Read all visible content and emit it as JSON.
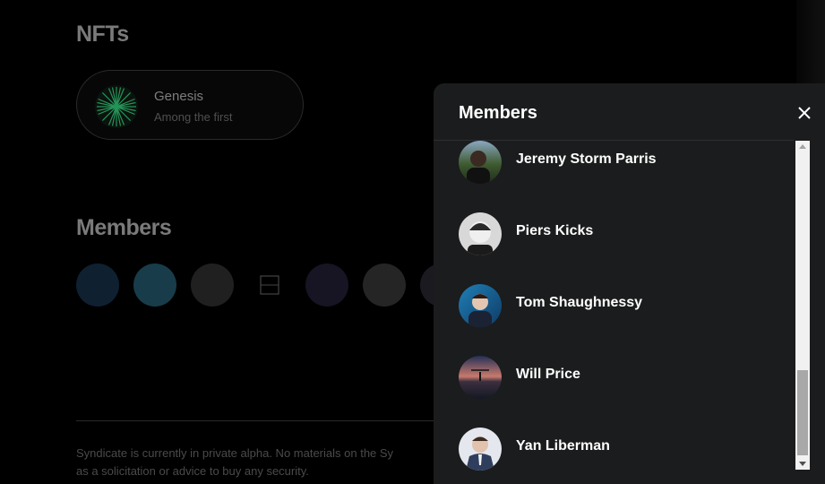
{
  "nfts": {
    "heading": "NFTs",
    "card": {
      "name": "Genesis",
      "description": "Among the first"
    }
  },
  "members_section": {
    "heading": "Members",
    "avatars": [
      {
        "name": "member-1",
        "color": "#1c3b5a"
      },
      {
        "name": "member-2",
        "color": "#2d6e87"
      },
      {
        "name": "member-3",
        "color": "#3a3a3a"
      },
      {
        "name": "colab-logo",
        "color": "#000000"
      },
      {
        "name": "member-5",
        "color": "#2a2540"
      },
      {
        "name": "member-6",
        "color": "#444444"
      },
      {
        "name": "member-7",
        "color": "#2f2f3a"
      }
    ]
  },
  "footer": {
    "text_line1": "Syndicate is currently in private alpha. No materials on the Sy",
    "text_line2": "as a solicitation or advice to buy any security."
  },
  "modal": {
    "title": "Members",
    "close_label": "×",
    "members": [
      {
        "name": "Jeremy Storm Parris",
        "color_top": "#8aa7c2",
        "color_bottom": "#2f3b2a"
      },
      {
        "name": "Piers Kicks",
        "color_top": "#d7d7d7",
        "color_bottom": "#3a3a3a"
      },
      {
        "name": "Tom Shaughnessy",
        "color_top": "#1f7fb6",
        "color_bottom": "#102a44"
      },
      {
        "name": "Will Price",
        "color_top": "#c87b7b",
        "color_bottom": "#2b2c4a"
      },
      {
        "name": "Yan Liberman",
        "color_top": "#d9dee4",
        "color_bottom": "#3b4b68"
      }
    ]
  },
  "colors": {
    "background": "#000000",
    "modal": "#1b1c1d",
    "accent_green": "#2fbf71"
  }
}
